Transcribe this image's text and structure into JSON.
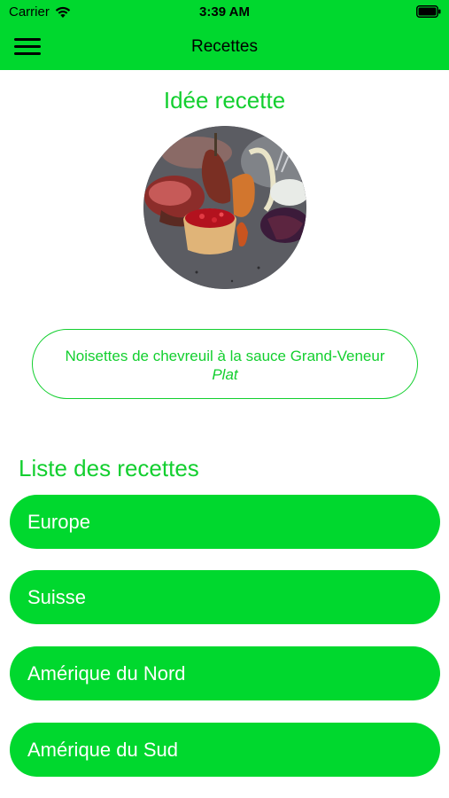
{
  "status_bar": {
    "carrier": "Carrier",
    "time": "3:39 AM",
    "wifi_icon": "wifi-icon",
    "battery_icon": "battery-icon"
  },
  "nav": {
    "title": "Recettes",
    "menu_icon": "hamburger-menu-icon"
  },
  "idea": {
    "title": "Idée recette",
    "recipe_name": "Noisettes de chevreuil à la sauce Grand-Veneur",
    "recipe_type": "Plat"
  },
  "list": {
    "title": "Liste des recettes",
    "categories": [
      "Europe",
      "Suisse",
      "Amérique du Nord",
      "Amérique du Sud"
    ]
  },
  "colors": {
    "brand_green": "#00d82e",
    "accent_text": "#13cf2f",
    "white": "#ffffff"
  }
}
